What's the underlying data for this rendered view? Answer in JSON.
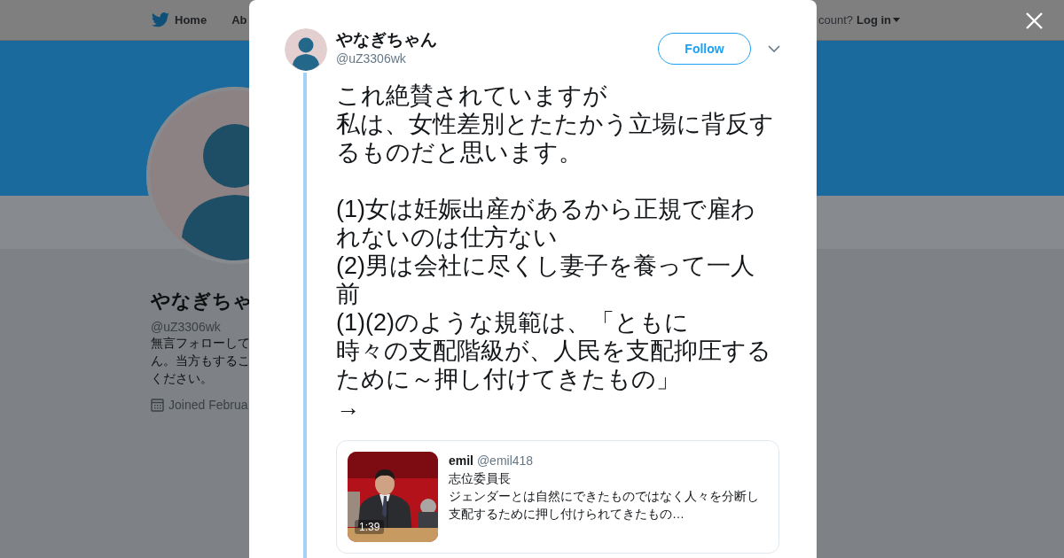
{
  "nav": {
    "items": [
      {
        "label": "Home",
        "kind": "home"
      },
      {
        "label": "Ab",
        "kind": "plain"
      }
    ],
    "account_prompt": "count?",
    "login": "Log in"
  },
  "profile": {
    "name": "やなぎちゃ",
    "handle": "@uZ3306wk",
    "bio_lines": [
      "無言フォローして",
      "ん。当方もするこ",
      "ください。"
    ],
    "joined": "Joined Februa"
  },
  "tweet": {
    "name": "やなぎちゃん",
    "handle": "@uZ3306wk",
    "follow_label": "Follow",
    "text_blocks": [
      [
        "これ絶賛されていますが",
        "私は、女性差別とたたかう立場に背反す",
        "るものだと思います。"
      ],
      [
        "(1)女は妊娠出産があるから正規で雇わ",
        "れないのは仕方ない",
        "(2)男は会社に尽くし妻子を養って一人",
        "前",
        "(1)(2)のような規範は、「ともに",
        "時々の支配階級が、人民を支配抑圧する",
        "ために～押し付けてきたもの」",
        "→"
      ]
    ],
    "quote": {
      "name": "emil",
      "handle": "@emil418",
      "duration": "1:39",
      "title": "志位委員長",
      "text": "ジェンダーとは自然にできたものではなく人々を分断し支配するために押し付けられてきたもの…"
    }
  }
}
